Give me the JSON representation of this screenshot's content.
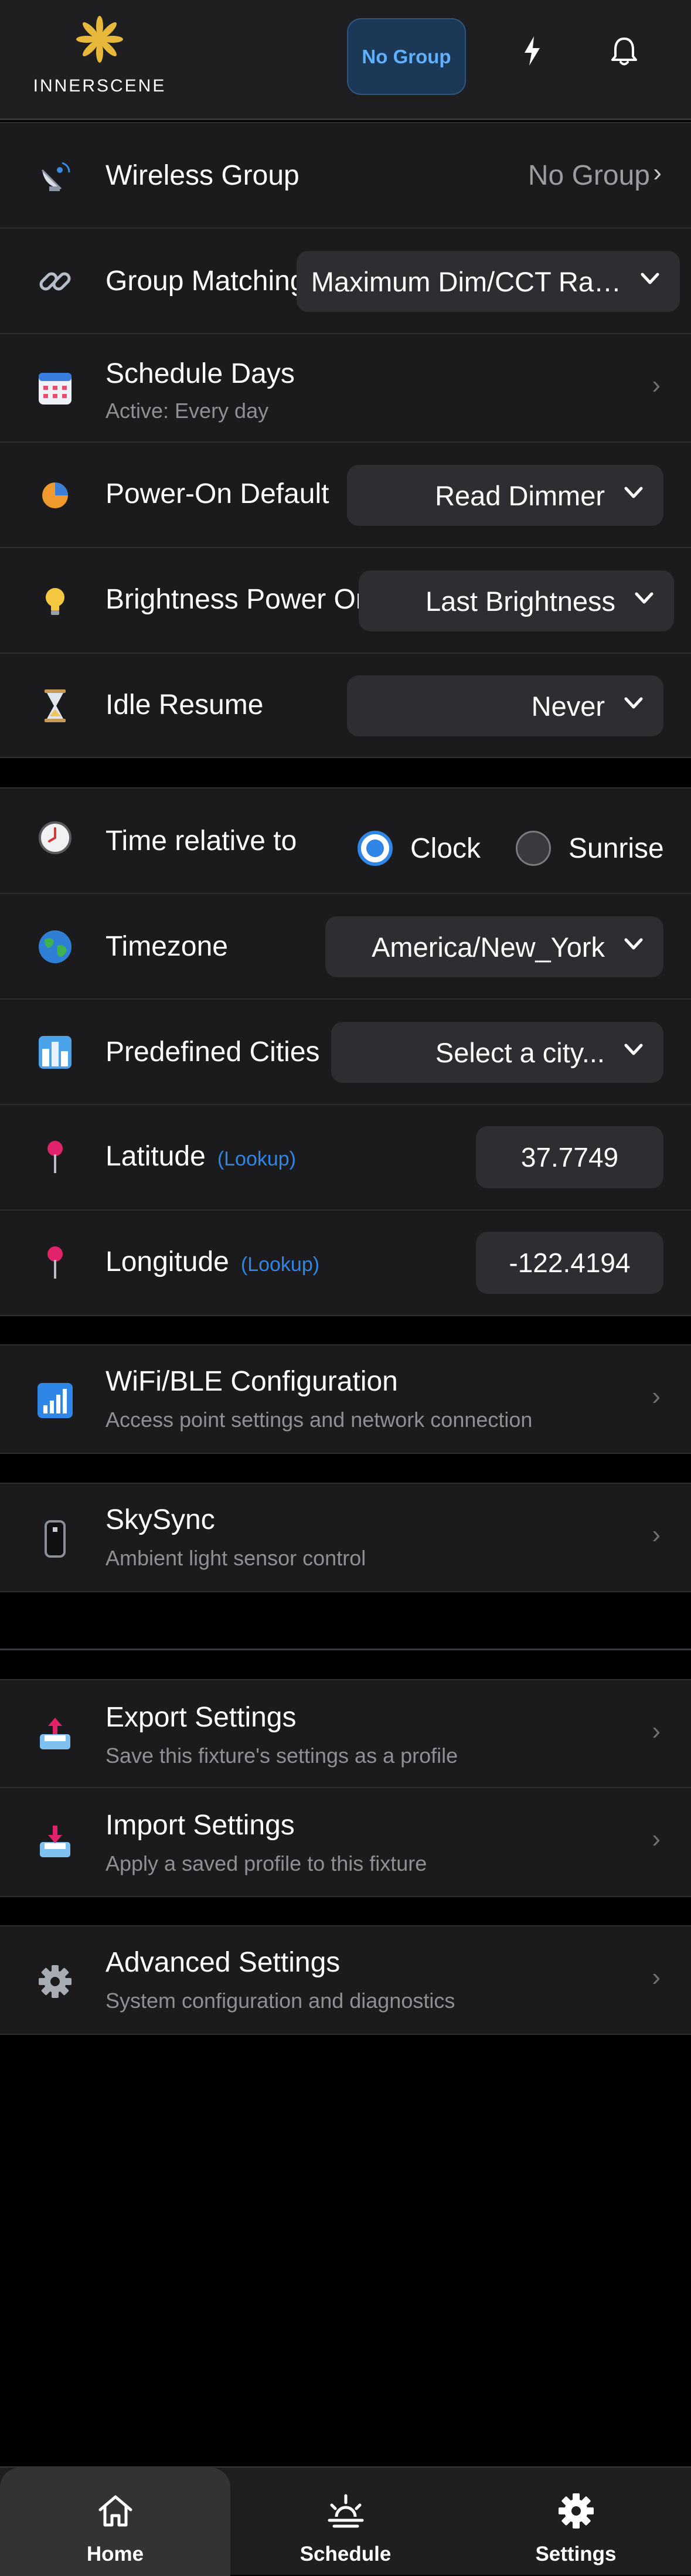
{
  "header": {
    "logo_text": "INNERSCENE",
    "group_button": "No Group"
  },
  "device_settings": {
    "wireless_group": {
      "label": "Wireless Group",
      "value": "No Group",
      "chevron": "›"
    },
    "group_matching": {
      "label": "Group Matching",
      "value": "Maximum Dim/CCT Ra…"
    },
    "schedule_days": {
      "label": "Schedule Days",
      "sub": "Active: Every day",
      "chevron": "›"
    },
    "power_on_default": {
      "label": "Power-On Default",
      "value": "Read Dimmer"
    },
    "brightness_power_on": {
      "label": "Brightness Power On",
      "value": "Last Brightness"
    },
    "idle_resume": {
      "label": "Idle Resume",
      "value": "Never"
    }
  },
  "location": {
    "time_relative": {
      "label": "Time relative to",
      "options": [
        "Clock",
        "Sunrise"
      ],
      "selected": "Clock"
    },
    "timezone": {
      "label": "Timezone",
      "value": "America/New_York"
    },
    "cities": {
      "label": "Predefined Cities",
      "value": "Select a city..."
    },
    "latitude": {
      "label": "Latitude",
      "lookup": "(Lookup)",
      "value": "37.7749"
    },
    "longitude": {
      "label": "Longitude",
      "lookup": "(Lookup)",
      "value": "-122.4194"
    }
  },
  "wifi": {
    "title": "WiFi/BLE Configuration",
    "sub": "Access point settings and network connection",
    "chevron": "›"
  },
  "skysync": {
    "title": "SkySync",
    "sub": "Ambient light sensor control",
    "chevron": "›"
  },
  "export": {
    "title": "Export Settings",
    "sub": "Save this fixture's settings as a profile",
    "chevron": "›"
  },
  "import": {
    "title": "Import Settings",
    "sub": "Apply a saved profile to this fixture",
    "chevron": "›"
  },
  "advanced": {
    "title": "Advanced Settings",
    "sub": "System configuration and diagnostics",
    "chevron": "›"
  },
  "nav": {
    "items": [
      {
        "label": "Home",
        "icon": "home-icon",
        "active": true
      },
      {
        "label": "Schedule",
        "icon": "sunrise-icon",
        "active": false
      },
      {
        "label": "Settings",
        "icon": "gear-icon",
        "active": false
      }
    ]
  },
  "colors": {
    "accent": "#2f86e6",
    "group_button_text": "#5fb0ff",
    "background": "#000000",
    "card": "#1b1b1d",
    "logo_gold": "#e8b83a"
  }
}
